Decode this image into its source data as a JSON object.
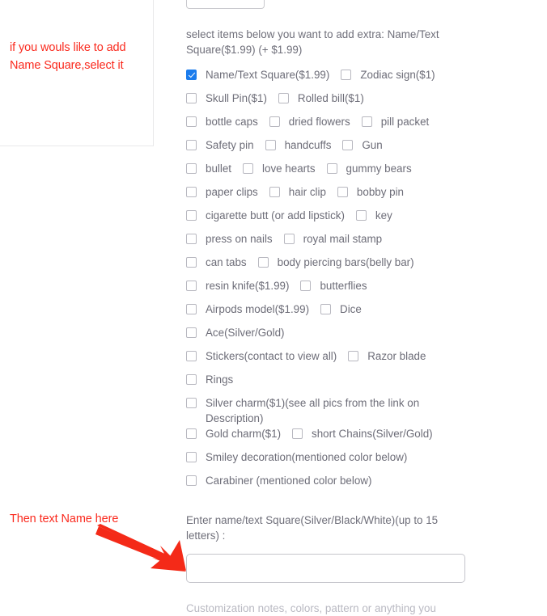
{
  "annotations": {
    "top_note": "if you wouls like to add Name Square,select it",
    "bottom_note": "Then text Name here",
    "color": "#fa2a1e",
    "arrow_icon": "red-arrow-icon"
  },
  "form": {
    "intro_text": "select items below you want to add extra:  Name/Text Square($1.99)  (+ $1.99)",
    "rows": [
      [
        {
          "label": "Name/Text Square($1.99)",
          "checked": true
        },
        {
          "label": "Zodiac sign($1)",
          "checked": false
        }
      ],
      [
        {
          "label": "Skull Pin($1)",
          "checked": false
        },
        {
          "label": "Rolled bill($1)",
          "checked": false
        }
      ],
      [
        {
          "label": "bottle caps",
          "checked": false
        },
        {
          "label": "dried flowers",
          "checked": false
        },
        {
          "label": "pill packet",
          "checked": false
        }
      ],
      [
        {
          "label": "Safety pin",
          "checked": false
        },
        {
          "label": "handcuffs",
          "checked": false
        },
        {
          "label": "Gun",
          "checked": false
        }
      ],
      [
        {
          "label": "bullet",
          "checked": false
        },
        {
          "label": "love hearts",
          "checked": false
        },
        {
          "label": "gummy bears",
          "checked": false
        }
      ],
      [
        {
          "label": "paper clips",
          "checked": false
        },
        {
          "label": "hair clip",
          "checked": false
        },
        {
          "label": "bobby pin",
          "checked": false
        }
      ],
      [
        {
          "label": "cigarette butt (or add lipstick)",
          "checked": false
        },
        {
          "label": "key",
          "checked": false
        }
      ],
      [
        {
          "label": "press on nails",
          "checked": false
        },
        {
          "label": "royal mail stamp",
          "checked": false
        }
      ],
      [
        {
          "label": "can tabs",
          "checked": false
        },
        {
          "label": "body piercing bars(belly bar)",
          "checked": false
        }
      ],
      [
        {
          "label": "resin knife($1.99)",
          "checked": false
        },
        {
          "label": "butterflies",
          "checked": false
        }
      ],
      [
        {
          "label": "Airpods model($1.99)",
          "checked": false
        },
        {
          "label": "Dice",
          "checked": false
        }
      ],
      [
        {
          "label": "Ace(Silver/Gold)",
          "checked": false
        }
      ],
      [
        {
          "label": "Stickers(contact to view all)",
          "checked": false
        },
        {
          "label": "Razor blade",
          "checked": false
        }
      ],
      [
        {
          "label": "Rings",
          "checked": false
        }
      ],
      [
        {
          "label": "Silver charm($1)(see all pics from the link on Description)",
          "checked": false,
          "wrap": true
        }
      ],
      [
        {
          "label": "Gold charm($1)",
          "checked": false
        },
        {
          "label": "short Chains(Silver/Gold)",
          "checked": false
        }
      ],
      [
        {
          "label": "Smiley decoration(mentioned color below)",
          "checked": false
        }
      ],
      [
        {
          "label": "Carabiner (mentioned color below)",
          "checked": false
        }
      ]
    ],
    "name_field_label": "Enter name/text Square(Silver/Black/White)(up to 15 letters) :",
    "name_field_value": "",
    "name_field_placeholder": "",
    "trailing_label": "Customization notes, colors, pattern or anything you",
    "checked_accent_color": "#1b7ced",
    "label_color": "#6d6d78"
  }
}
